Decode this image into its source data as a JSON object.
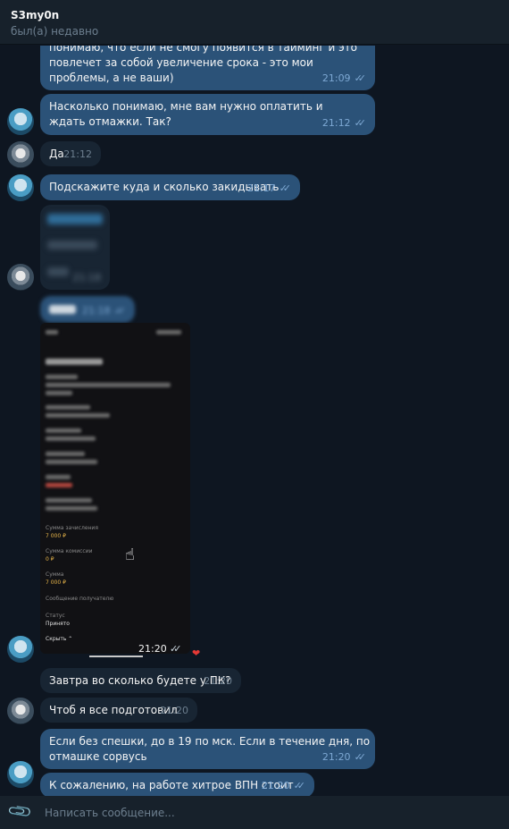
{
  "header": {
    "title": "S3my0n",
    "status": "был(а) недавно"
  },
  "messages": [
    {
      "id": "m1",
      "dir": "out",
      "text": "понимаю, что если не смогу появится в тайминг и это повлечет за собой увеличение срока - это мои проблемы, а не ваши)",
      "time": "21:09",
      "read": true
    },
    {
      "id": "m2",
      "dir": "out",
      "text": "Насколько понимаю, мне вам нужно оплатить и ждать отмажки. Так?",
      "time": "21:12",
      "read": true
    },
    {
      "id": "m3",
      "dir": "in",
      "text": "Да",
      "time": "21:12"
    },
    {
      "id": "m4",
      "dir": "out",
      "text": "Подскажите куда и сколько закидывать",
      "time": "21:17",
      "read": true
    },
    {
      "id": "m5",
      "dir": "in",
      "text": "",
      "time": "21:18",
      "blurred": true
    },
    {
      "id": "m6",
      "dir": "out",
      "text": "",
      "time": "21:18",
      "blurred": true
    },
    {
      "id": "m7",
      "dir": "out",
      "text": "",
      "time": "21:20",
      "reaction": "❤",
      "image": true
    },
    {
      "id": "m8",
      "dir": "in",
      "text": "Завтра во сколько будете у ПК?",
      "time": "21:20"
    },
    {
      "id": "m9",
      "dir": "in",
      "text": "Чтоб я все подготовил",
      "time": "21:20"
    },
    {
      "id": "m10",
      "dir": "out",
      "text": "Если без спешки, до в 19 по мск. Если в течение дня, по отмашке сорвусь",
      "time": "21:20",
      "read": true
    },
    {
      "id": "m11",
      "dir": "out",
      "text": "К сожалению, на работе хитрое ВПН стоит",
      "time": "21:20",
      "read": true
    }
  ],
  "receipt": {
    "labels": [
      {
        "id": "sum_credit",
        "label": "Сумма зачисления",
        "value": "7 000 ₽"
      },
      {
        "id": "commission",
        "label": "Сумма комиссии",
        "value": "0 ₽"
      },
      {
        "id": "sum",
        "label": "Сумма",
        "value": "7 000 ₽"
      },
      {
        "id": "message",
        "label": "Сообщение получателю",
        "value": ""
      },
      {
        "id": "status",
        "label": "Статус",
        "value": "Принято"
      }
    ],
    "hide_label": "Скрыть"
  },
  "composer": {
    "placeholder": "Написать сообщение..."
  },
  "colors": {
    "bg": "#0e1621",
    "outgoing": "#2b5278",
    "incoming": "#182533",
    "accent": "#7da8d3",
    "heart": "#e53935"
  },
  "icons": {
    "attach": "paperclip-icon",
    "read": "double-check-icon",
    "cursor": "hand-cursor-icon"
  }
}
